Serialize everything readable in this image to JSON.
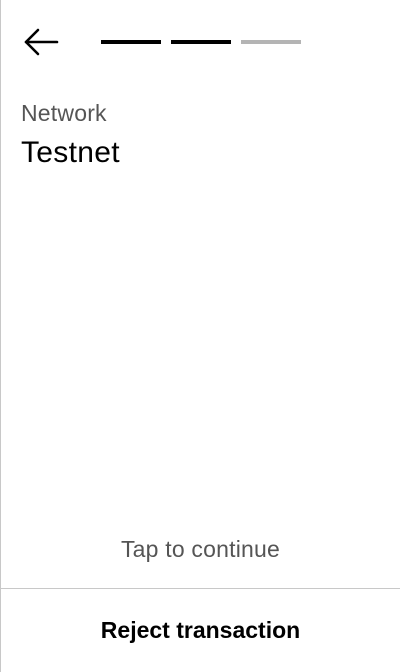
{
  "header": {
    "back_icon": "arrow-left-icon",
    "progress": {
      "total_steps": 3,
      "completed_steps": 2,
      "active_color": "#000000",
      "inactive_color": "#b4b4b4"
    }
  },
  "field": {
    "label": "Network",
    "value": "Testnet"
  },
  "footer": {
    "hint": "Tap to continue",
    "reject_label": "Reject transaction"
  }
}
